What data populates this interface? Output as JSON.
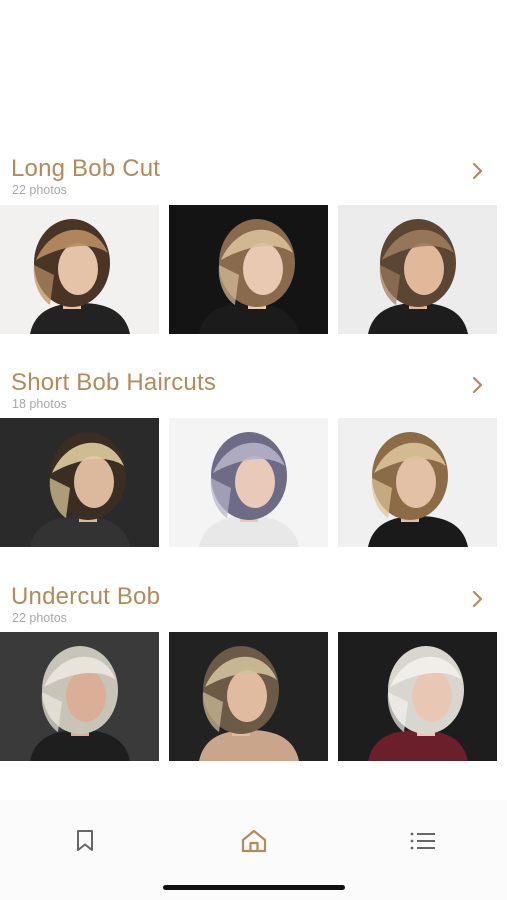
{
  "sections": [
    {
      "title": "Long Bob Cut",
      "count": "22 photos",
      "photos": [
        {
          "bg": "#f2f1ef",
          "hair": "#4a3426",
          "hair_light": "#b98e63",
          "skin": "#e5c3a8",
          "shirt": "#222222"
        },
        {
          "bg": "#141414",
          "hair": "#8a6a4d",
          "hair_light": "#d9c09b",
          "skin": "#e9c9b2",
          "shirt": "#1b1b1b"
        },
        {
          "bg": "#ececec",
          "hair": "#5b4533",
          "hair_light": "#9c7b5c",
          "skin": "#e0b99b",
          "shirt": "#1d1d1d"
        }
      ]
    },
    {
      "title": "Short Bob Haircuts",
      "count": "18 photos",
      "photos": [
        {
          "bg": "#2a2a2a",
          "hair": "#3a2d22",
          "hair_light": "#e0cc9c",
          "skin": "#dcb89d",
          "shirt": "#333333"
        },
        {
          "bg": "#f4f4f4",
          "hair": "#6e6b86",
          "hair_light": "#b5b3c8",
          "skin": "#e9c9b7",
          "shirt": "#e8e8e8"
        },
        {
          "bg": "#f0f0f0",
          "hair": "#8c6c47",
          "hair_light": "#dcc39a",
          "skin": "#e3c1a6",
          "shirt": "#1a1a1a"
        }
      ]
    },
    {
      "title": "Undercut Bob",
      "count": "22 photos",
      "photos": [
        {
          "bg": "#3a3a3a",
          "hair": "#c9c4b8",
          "hair_light": "#ece8df",
          "skin": "#d9b097",
          "shirt": "#1e1e1e"
        },
        {
          "bg": "#222222",
          "hair": "#6b5a46",
          "hair_light": "#d2c09a",
          "skin": "#e1bb9f",
          "shirt": "#c9a58c"
        },
        {
          "bg": "#1d1d1d",
          "hair": "#d9d6cf",
          "hair_light": "#f3f1ec",
          "skin": "#e8c8b4",
          "shirt": "#6a1f2a"
        }
      ]
    }
  ],
  "tabbar": {
    "items": [
      {
        "icon": "bookmark-icon",
        "active": false
      },
      {
        "icon": "home-icon",
        "active": true
      },
      {
        "icon": "list-icon",
        "active": false
      }
    ]
  },
  "colors": {
    "accent": "#b38a5a",
    "inactive_icon": "#666666"
  }
}
